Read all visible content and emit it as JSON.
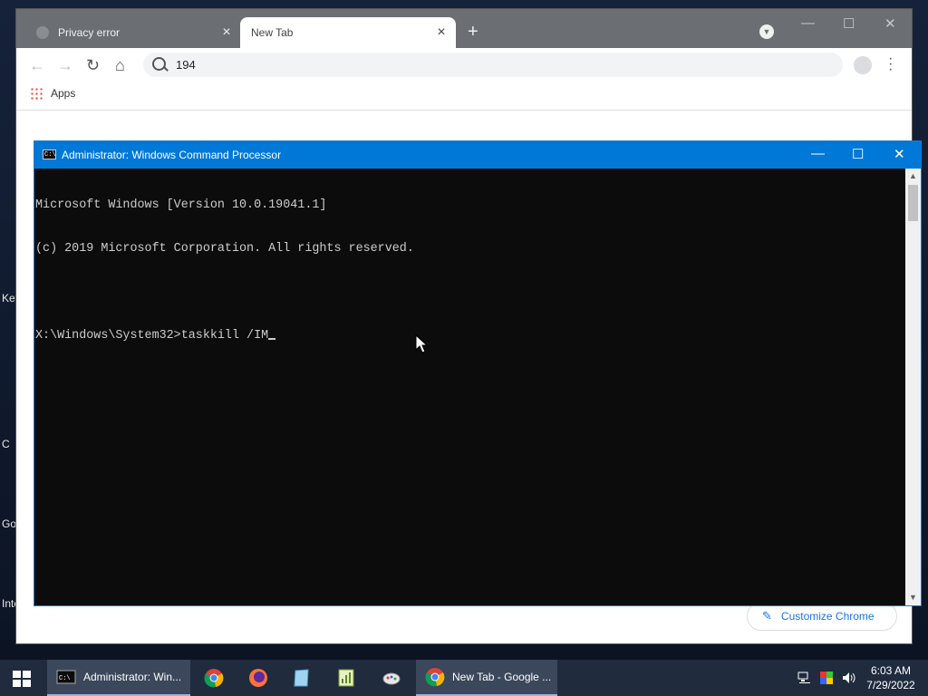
{
  "desktop": {
    "side_labels": [
      "Key",
      "C",
      "Go",
      "Inte"
    ]
  },
  "chrome": {
    "tabs": [
      {
        "title": "Privacy error"
      },
      {
        "title": "New Tab"
      }
    ],
    "omnibox_text": "194",
    "bookmarks": {
      "apps_label": "Apps"
    },
    "customize_label": "Customize Chrome"
  },
  "cmd": {
    "title": "Administrator: Windows Command Processor",
    "lines": [
      "Microsoft Windows [Version 10.0.19041.1]",
      "(c) 2019 Microsoft Corporation. All rights reserved.",
      "",
      "X:\\Windows\\System32>taskkill /IM"
    ]
  },
  "taskbar": {
    "cmd_button_label": "Administrator: Win...",
    "chrome_button_label": "New Tab - Google ...",
    "time": "6:03 AM",
    "date": "7/29/2022"
  }
}
